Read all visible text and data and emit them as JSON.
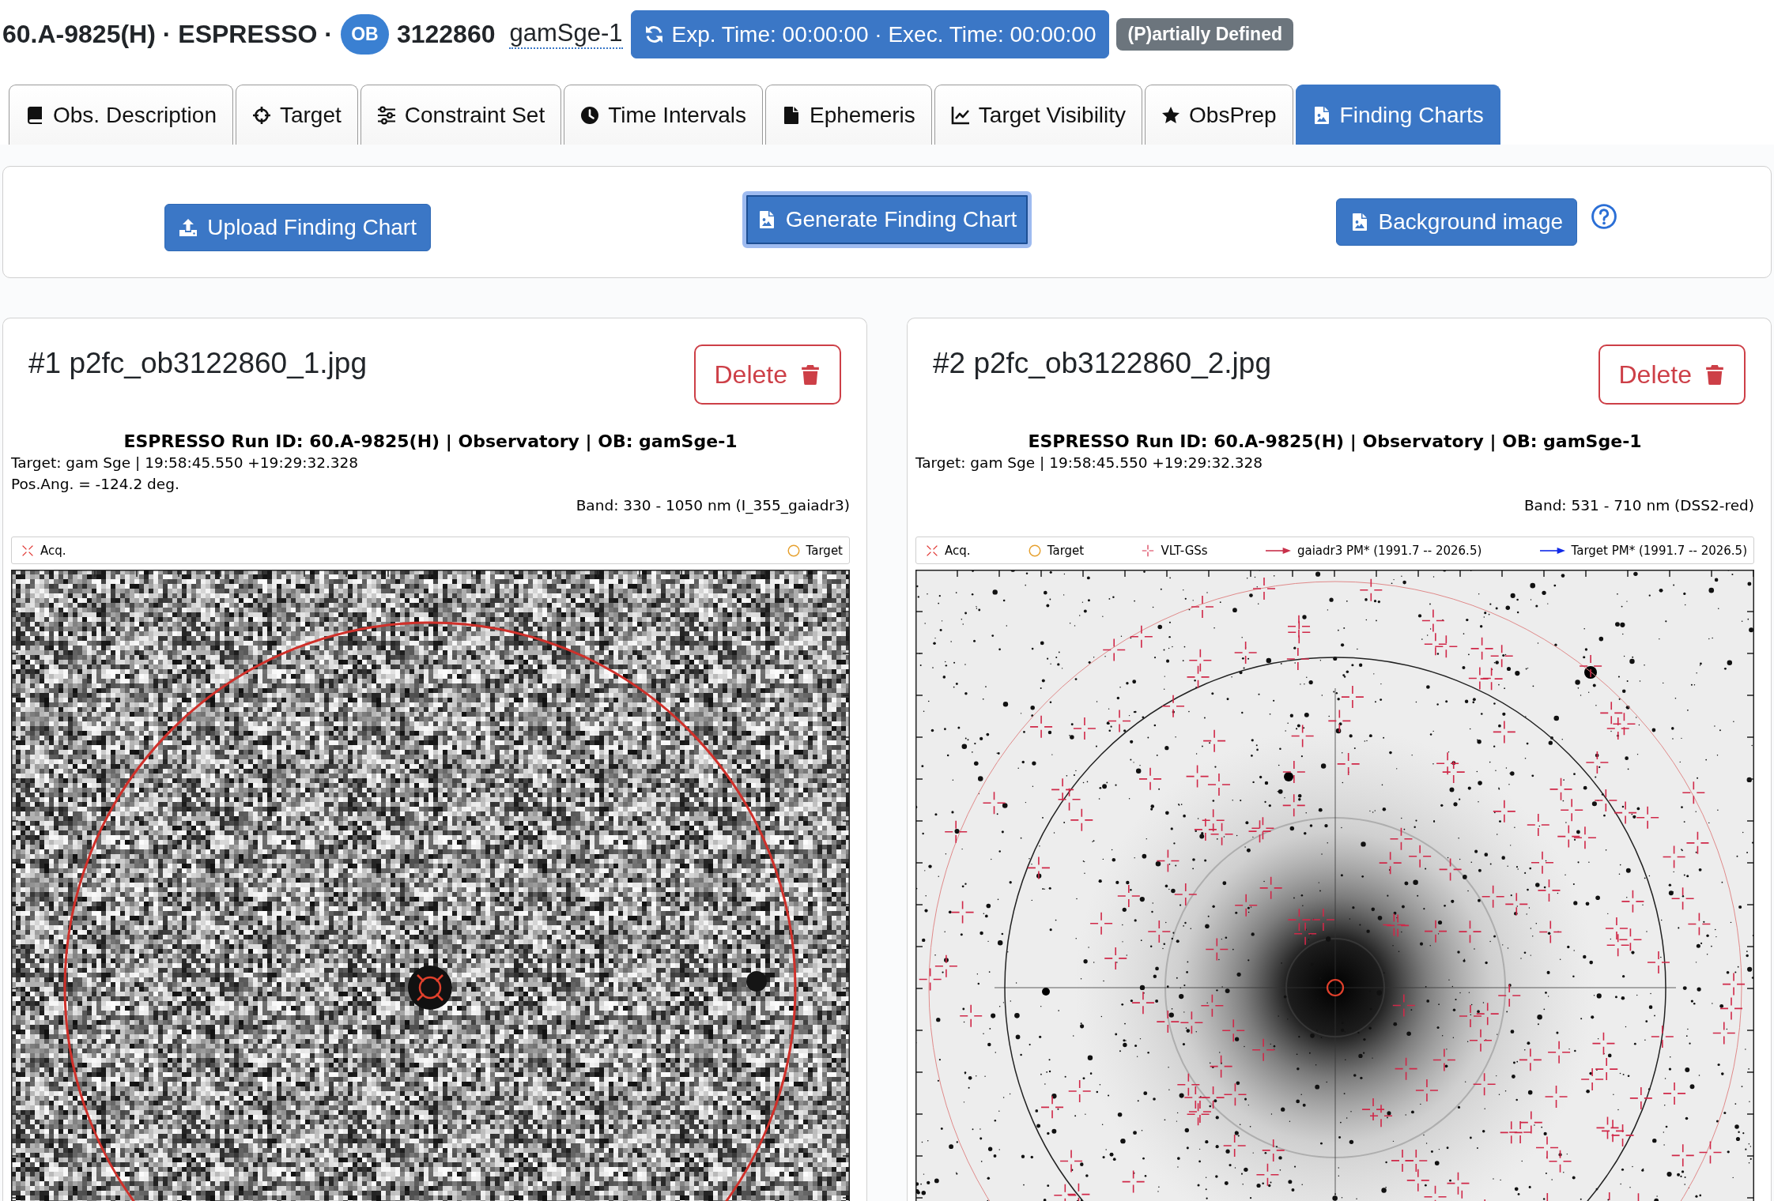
{
  "header": {
    "title": "60.A-9825(H) · ESPRESSO ·",
    "ob_badge": "OB",
    "ob_id": "3122860",
    "ob_name": "gamSge-1",
    "time_button": "Exp. Time: 00:00:00 · Exec. Time: 00:00:00",
    "status_badge": "(P)artially Defined"
  },
  "tabs": [
    {
      "label": "Obs. Description",
      "selected": false
    },
    {
      "label": "Target",
      "selected": false
    },
    {
      "label": "Constraint Set",
      "selected": false
    },
    {
      "label": "Time Intervals",
      "selected": false
    },
    {
      "label": "Ephemeris",
      "selected": false
    },
    {
      "label": "Target Visibility",
      "selected": false
    },
    {
      "label": "ObsPrep",
      "selected": false
    },
    {
      "label": "Finding Charts",
      "selected": true
    }
  ],
  "toolbar": {
    "buttons": [
      {
        "label": "Upload Finding Chart",
        "focused": false,
        "help_icon": false
      },
      {
        "label": "Generate Finding Chart",
        "focused": true,
        "help_icon": false
      },
      {
        "label": "Background image",
        "focused": false,
        "help_icon": true
      }
    ]
  },
  "finding_charts": [
    {
      "title": "#1 p2fc_ob3122860_1.jpg",
      "delete_label": "Delete",
      "kind": "noise",
      "heading": "ESPRESSO Run ID: 60.A-9825(H) | Observatory | OB: gamSge-1",
      "info_lines": [
        "Target: gam Sge | 19:58:45.550 +19:29:32.328",
        "Pos.Ang. = -124.2 deg."
      ],
      "band": "Band: 330 - 1050 nm (I_355_gaiadr3)",
      "legend": [
        {
          "kind": "acq",
          "label": "Acq."
        },
        {
          "kind": "target",
          "label": "Target"
        }
      ]
    },
    {
      "title": "#2 p2fc_ob3122860_2.jpg",
      "delete_label": "Delete",
      "kind": "starfield",
      "heading": "ESPRESSO Run ID: 60.A-9825(H) | Observatory | OB: gamSge-1",
      "info_lines": [
        "Target: gam Sge | 19:58:45.550 +19:29:32.328"
      ],
      "band": "Band: 531 - 710 nm (DSS2-red)",
      "legend": [
        {
          "kind": "acq",
          "label": "Acq."
        },
        {
          "kind": "target",
          "label": "Target"
        },
        {
          "kind": "guide_star",
          "label": "VLT-GSs"
        },
        {
          "kind": "catalog_pm",
          "label": "gaiadr3 PM* (1991.7 -- 2026.5)"
        },
        {
          "kind": "target_pm",
          "label": "Target PM* (1991.7 -- 2026.5)"
        }
      ]
    }
  ]
}
